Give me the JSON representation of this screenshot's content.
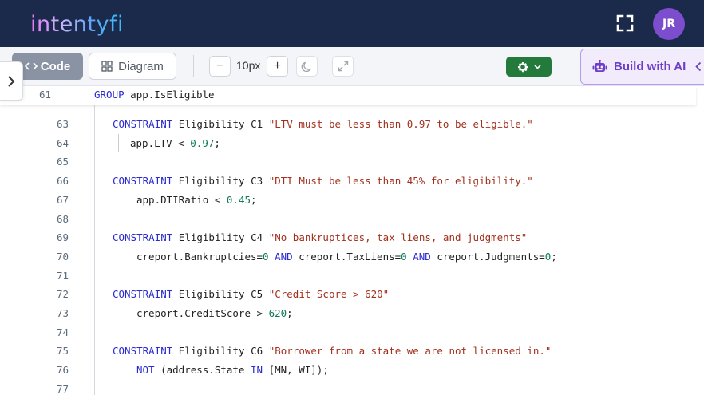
{
  "header": {
    "logo": "intentyfi",
    "avatar_initials": "JR",
    "fullscreen_icon": "fullscreen-icon"
  },
  "toolbar": {
    "code_label": "Code",
    "diagram_label": "Diagram",
    "zoom_minus": "−",
    "zoom_value": "10px",
    "zoom_plus": "+",
    "theme_icon": "moon-icon",
    "expand_icon": "expand-icon",
    "settings_icon": "gear-icon",
    "build_ai_label": "Build with AI"
  },
  "editor": {
    "sticky": {
      "num": "61",
      "keyword": "GROUP",
      "text": " app.IsEligible"
    },
    "lines": [
      {
        "num": "63",
        "kw": "CONSTRAINT",
        "name": " Eligibility C1 ",
        "str": "\"LTV must be less than 0.97 to be eligible.\""
      },
      {
        "num": "64",
        "a": "app.LTV < ",
        "n1": "0.97",
        "b": ";"
      },
      {
        "num": "65"
      },
      {
        "num": "66",
        "kw": "CONSTRAINT",
        "name": " Eligibility C3 ",
        "str": "\"DTI Must be less than 45% for eligibility.\""
      },
      {
        "num": "67",
        "a": "app.DTIRatio < ",
        "n1": "0.45",
        "b": ";"
      },
      {
        "num": "68"
      },
      {
        "num": "69",
        "kw": "CONSTRAINT",
        "name": " Eligibility C4 ",
        "str": "\"No bankruptices, tax liens, and judgments\""
      },
      {
        "num": "70",
        "p1": "creport.Bankruptcies=",
        "z1": "0",
        "and1": " AND ",
        "p2": "creport.TaxLiens=",
        "z2": "0",
        "and2": " AND ",
        "p3": "creport.Judgments=",
        "z3": "0",
        "end": ";"
      },
      {
        "num": "71"
      },
      {
        "num": "72",
        "kw": "CONSTRAINT",
        "name": " Eligibility C5 ",
        "str": "\"Credit Score > 620\""
      },
      {
        "num": "73",
        "a": "creport.CreditScore > ",
        "n1": "620",
        "b": ";"
      },
      {
        "num": "74"
      },
      {
        "num": "75",
        "kw": "CONSTRAINT",
        "name": " Eligibility C6 ",
        "str": "\"Borrower from a state we are not licensed in.\""
      },
      {
        "num": "76",
        "not": "NOT",
        "a": " (address.State ",
        "in": "IN",
        "b": " [MN, WI]);"
      },
      {
        "num": "77"
      }
    ]
  }
}
